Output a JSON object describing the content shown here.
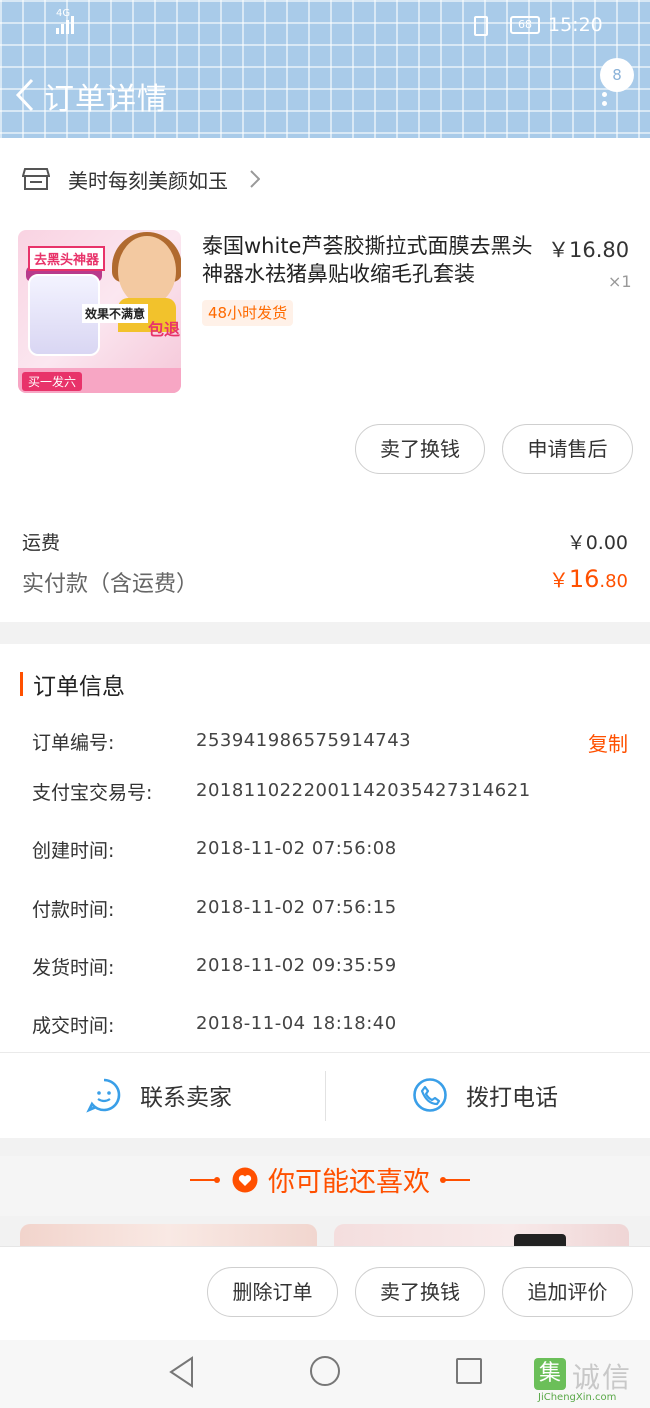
{
  "status_bar": {
    "signal_label": "4G",
    "battery": "68",
    "time": "15:20"
  },
  "header": {
    "title": "订单详情",
    "badge_count": "8"
  },
  "shop": {
    "name": "美时每刻美颜如玉"
  },
  "product": {
    "title": "泰国white芦荟胶撕拉式面膜去黑头神器水祛猪鼻贴收缩毛孔套装",
    "price": "￥16.80",
    "quantity": "×1",
    "shipping_tag": "48小时发货",
    "image_texts": {
      "tag": "去黑头神器",
      "slogan": "效果不满意",
      "promise": "包退",
      "bottom": "买一发六"
    }
  },
  "item_buttons": {
    "sell_exchange": "卖了换钱",
    "after_sale": "申请售后"
  },
  "fees": {
    "shipping_label": "运费",
    "shipping_value": "￥0.00",
    "paid_label": "实付款（含运费）",
    "paid_currency": "￥",
    "paid_integer": "16",
    "paid_decimal": ".80"
  },
  "order_info": {
    "title": "订单信息",
    "copy_label": "复制",
    "rows": [
      {
        "label": "订单编号:",
        "value": "253941986575914743"
      },
      {
        "label": "支付宝交易号:",
        "value": "2018110222001142035427314621"
      },
      {
        "label": "创建时间:",
        "value": "2018-11-02 07:56:08"
      },
      {
        "label": "付款时间:",
        "value": "2018-11-02 07:56:15"
      },
      {
        "label": "发货时间:",
        "value": "2018-11-02 09:35:59"
      },
      {
        "label": "成交时间:",
        "value": "2018-11-04 18:18:40"
      }
    ]
  },
  "actions": {
    "contact_seller": "联系卖家",
    "call_phone": "拨打电话"
  },
  "recommend": {
    "title": "你可能还喜欢"
  },
  "bottom_bar": {
    "delete_order": "删除订单",
    "sell_exchange": "卖了换钱",
    "add_review": "追加评价"
  },
  "watermark": {
    "box": "集",
    "text": "诚信",
    "url": "JiChengXin.com"
  },
  "colors": {
    "accent": "#ff5000",
    "header_bg": "#a9cbe9",
    "action_icon": "#3a9fe8"
  }
}
